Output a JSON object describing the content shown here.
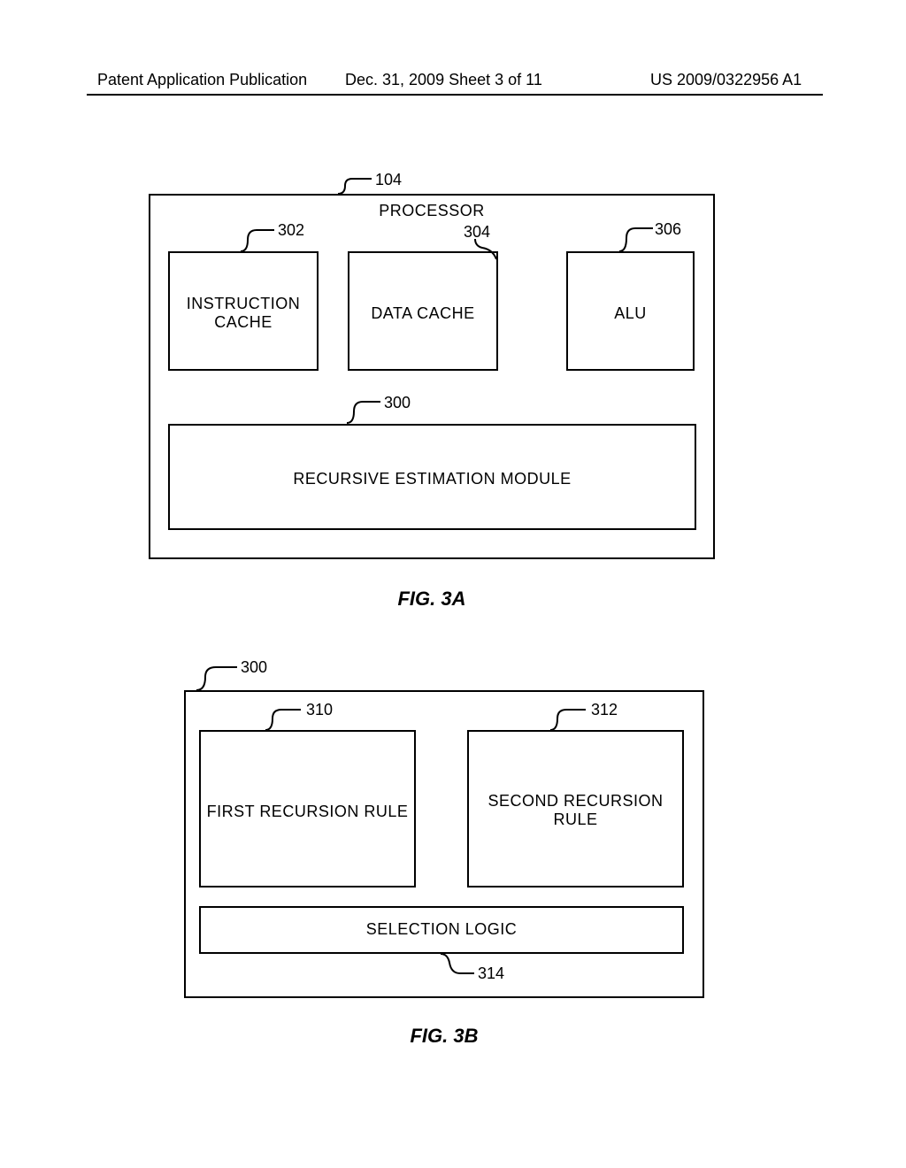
{
  "header": {
    "left": "Patent Application Publication",
    "mid": "Dec. 31, 2009   Sheet 3 of 11",
    "right": "US 2009/0322956 A1"
  },
  "figA": {
    "outer_title": "PROCESSOR",
    "ref_outer": "104",
    "box1": {
      "label": "INSTRUCTION\nCACHE",
      "ref": "302"
    },
    "box2": {
      "label": "DATA CACHE",
      "ref": "304"
    },
    "box3": {
      "label": "ALU",
      "ref": "306"
    },
    "box4": {
      "label": "RECURSIVE ESTIMATION MODULE",
      "ref": "300"
    },
    "caption": "FIG. 3A"
  },
  "figB": {
    "ref_outer": "300",
    "box1": {
      "label": "FIRST RECURSION RULE",
      "ref": "310"
    },
    "box2": {
      "label": "SECOND RECURSION\nRULE",
      "ref": "312"
    },
    "box3": {
      "label": "SELECTION LOGIC",
      "ref": "314"
    },
    "caption": "FIG. 3B"
  }
}
